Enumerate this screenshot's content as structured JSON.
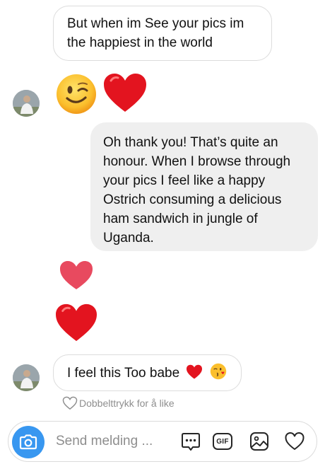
{
  "messages": [
    {
      "id": "b1",
      "text_line1": "But when im See your pics  im",
      "text_line2": "the happiest in the world"
    },
    {
      "id": "b2",
      "lines": [
        "Oh thank you! That’s quite an",
        "honour. When I browse through",
        "your pics I feel like a happy",
        "Ostrich consuming a delicious",
        "ham sandwich in jungle of",
        "Uganda."
      ]
    },
    {
      "id": "b3",
      "text": "I feel this Too babe"
    }
  ],
  "reactions": {
    "emoji_row1": [
      "winking-face-emoji",
      "red-heart-emoji"
    ],
    "heart_reaction_color": "#e84a5f",
    "heart_big_color": "#e3141f"
  },
  "like_hint": "Dobbelttrykk for å like",
  "composer": {
    "placeholder": "Send melding ...",
    "gif_label": "GIF",
    "accent": "#3897f0"
  }
}
